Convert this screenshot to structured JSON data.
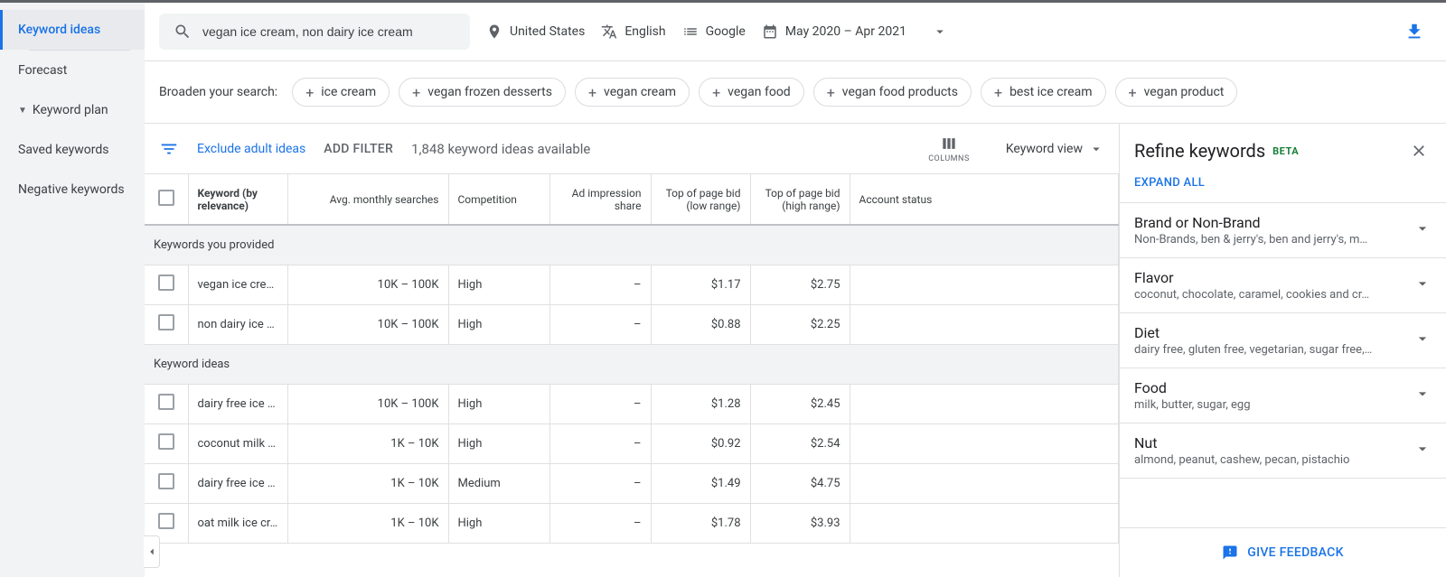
{
  "sidebar": {
    "items": [
      {
        "label": "Keyword ideas",
        "active": true
      },
      {
        "label": "Forecast"
      },
      {
        "label": "Keyword plan",
        "collapsible": true
      },
      {
        "label": "Saved keywords"
      },
      {
        "label": "Negative keywords"
      }
    ]
  },
  "controlbar": {
    "search_value": "vegan ice cream, non dairy ice cream",
    "location": "United States",
    "language": "English",
    "network": "Google",
    "date_range": "May 2020 – Apr 2021"
  },
  "broaden": {
    "label": "Broaden your search:",
    "chips": [
      "ice cream",
      "vegan frozen desserts",
      "vegan cream",
      "vegan food",
      "vegan food products",
      "best ice cream",
      "vegan product"
    ]
  },
  "toolbar": {
    "exclude_label": "Exclude adult ideas",
    "add_filter": "ADD FILTER",
    "ideas_count": "1,848 keyword ideas available",
    "columns_label": "COLUMNS",
    "view_label": "Keyword view"
  },
  "table": {
    "headers": {
      "keyword": "Keyword (by relevance)",
      "avg": "Avg. monthly searches",
      "competition": "Competition",
      "impression": "Ad impression share",
      "low": "Top of page bid (low range)",
      "high": "Top of page bid (high range)",
      "account": "Account status"
    },
    "section_provided": "Keywords you provided",
    "section_ideas": "Keyword ideas",
    "provided_rows": [
      {
        "kw": "vegan ice cre…",
        "avg": "10K – 100K",
        "comp": "High",
        "impr": "–",
        "low": "$1.17",
        "high": "$2.75"
      },
      {
        "kw": "non dairy ice …",
        "avg": "10K – 100K",
        "comp": "High",
        "impr": "–",
        "low": "$0.88",
        "high": "$2.25"
      }
    ],
    "idea_rows": [
      {
        "kw": "dairy free ice …",
        "avg": "10K – 100K",
        "comp": "High",
        "impr": "–",
        "low": "$1.28",
        "high": "$2.45"
      },
      {
        "kw": "coconut milk i…",
        "avg": "1K – 10K",
        "comp": "High",
        "impr": "–",
        "low": "$0.92",
        "high": "$2.54"
      },
      {
        "kw": "dairy free ice …",
        "avg": "1K – 10K",
        "comp": "Medium",
        "impr": "–",
        "low": "$1.49",
        "high": "$4.75"
      },
      {
        "kw": "oat milk ice cr…",
        "avg": "1K – 10K",
        "comp": "High",
        "impr": "–",
        "low": "$1.78",
        "high": "$3.93"
      }
    ]
  },
  "refine": {
    "title": "Refine keywords",
    "beta": "BETA",
    "expand_all": "EXPAND ALL",
    "categories": [
      {
        "title": "Brand or Non-Brand",
        "sub": "Non-Brands, ben & jerry's, ben and jerry's, m…"
      },
      {
        "title": "Flavor",
        "sub": "coconut, chocolate, caramel, cookies and cr…"
      },
      {
        "title": "Diet",
        "sub": "dairy free, gluten free, vegetarian, sugar free,…"
      },
      {
        "title": "Food",
        "sub": "milk, butter, sugar, egg"
      },
      {
        "title": "Nut",
        "sub": "almond, peanut, cashew, pecan, pistachio"
      }
    ],
    "feedback": "GIVE FEEDBACK"
  }
}
